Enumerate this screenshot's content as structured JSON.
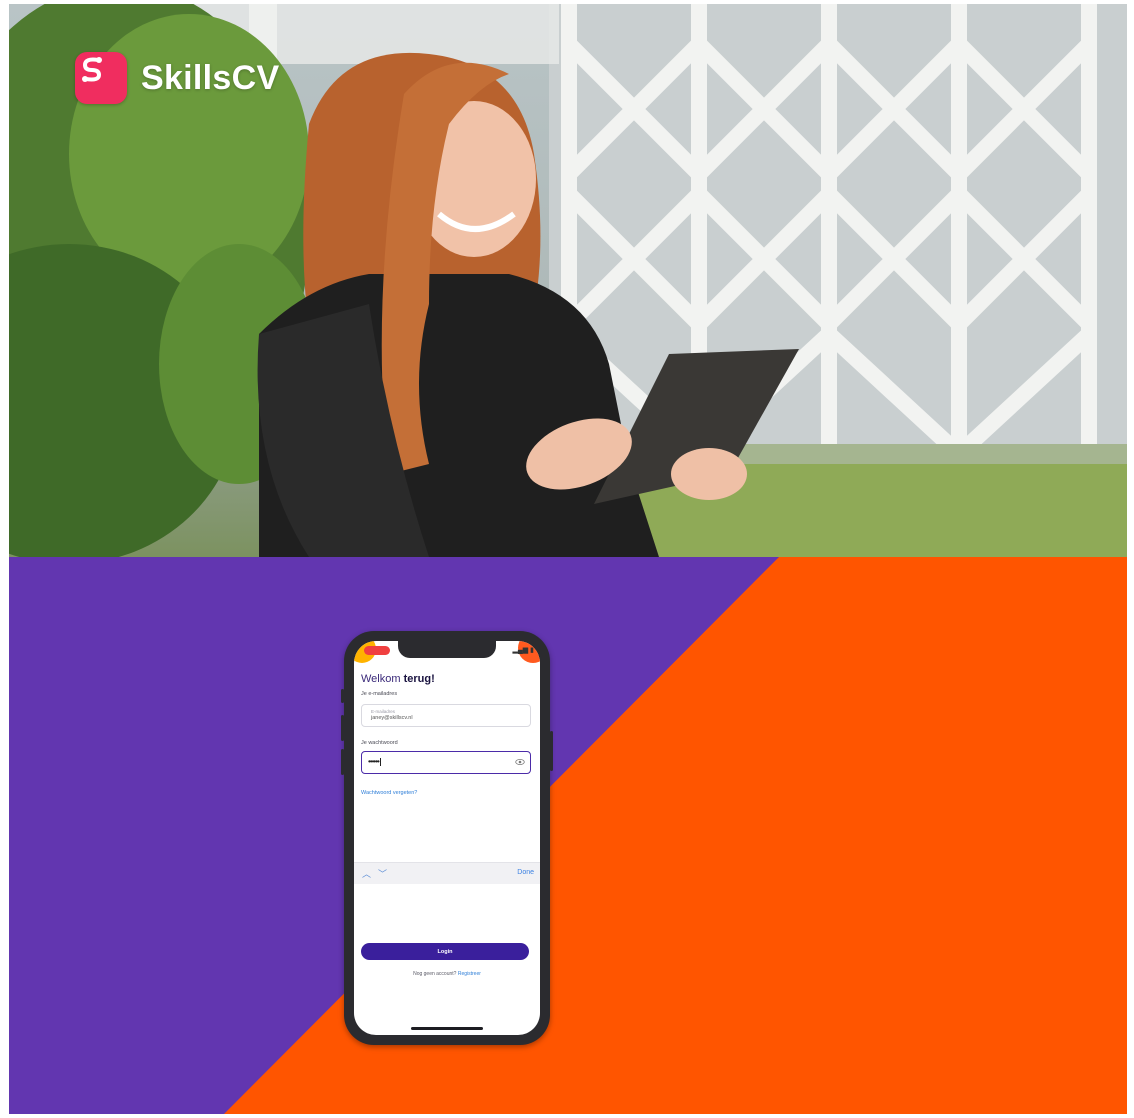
{
  "brand": {
    "name": "SkillsCV",
    "logo_icon": "s-link-icon",
    "logo_color": "#f02d5f"
  },
  "colors": {
    "purple": "#6236b0",
    "orange": "#ff5500",
    "button": "#3a1f9c",
    "link": "#2f7fd8"
  },
  "phone": {
    "title_regular": "Welkom ",
    "title_bold": "terug!",
    "email_label": "Je e-mailadres",
    "email_placeholder": "E-mailadres",
    "email_value": "janey@skillscv.nl",
    "password_label": "Je wachtwoord",
    "password_value": "••••••",
    "forgot_link": "Wachtwoord vergeten?",
    "keyboard_done": "Done",
    "login_button": "Login",
    "no_account": "Nog geen account?",
    "register_link": "Registreer"
  }
}
